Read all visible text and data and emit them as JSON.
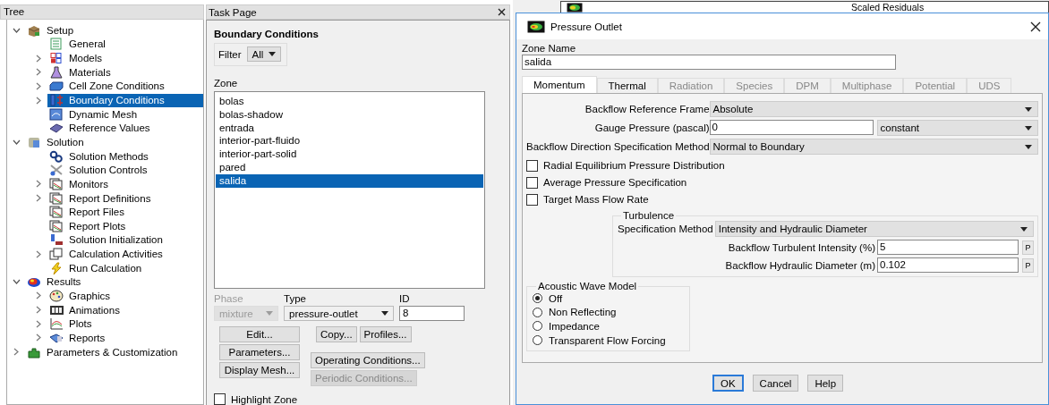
{
  "tree": {
    "title": "Tree",
    "items": [
      {
        "label": "Setup",
        "expanded": true,
        "selected": false,
        "children": [
          {
            "label": "General",
            "selected": false
          },
          {
            "label": "Models",
            "expanded": false,
            "selected": false
          },
          {
            "label": "Materials",
            "expanded": false,
            "selected": false
          },
          {
            "label": "Cell Zone Conditions",
            "expanded": false,
            "selected": false
          },
          {
            "label": "Boundary Conditions",
            "expanded": false,
            "selected": true
          },
          {
            "label": "Dynamic Mesh",
            "selected": false
          },
          {
            "label": "Reference Values",
            "selected": false
          }
        ]
      },
      {
        "label": "Solution",
        "expanded": true,
        "selected": false,
        "children": [
          {
            "label": "Solution Methods",
            "selected": false
          },
          {
            "label": "Solution Controls",
            "selected": false
          },
          {
            "label": "Monitors",
            "expanded": false,
            "selected": false
          },
          {
            "label": "Report Definitions",
            "expanded": false,
            "selected": false
          },
          {
            "label": "Report Files",
            "selected": false
          },
          {
            "label": "Report Plots",
            "selected": false
          },
          {
            "label": "Solution Initialization",
            "selected": false
          },
          {
            "label": "Calculation Activities",
            "expanded": false,
            "selected": false
          },
          {
            "label": "Run Calculation",
            "selected": false
          }
        ]
      },
      {
        "label": "Results",
        "expanded": true,
        "selected": false,
        "children": [
          {
            "label": "Graphics",
            "expanded": false,
            "selected": false
          },
          {
            "label": "Animations",
            "expanded": false,
            "selected": false
          },
          {
            "label": "Plots",
            "expanded": false,
            "selected": false
          },
          {
            "label": "Reports",
            "expanded": false,
            "selected": false
          }
        ]
      },
      {
        "label": "Parameters & Customization",
        "expanded": false,
        "selected": false
      }
    ]
  },
  "task_page": {
    "title": "Task Page",
    "heading": "Boundary Conditions",
    "filter": {
      "label": "Filter",
      "value": "All"
    },
    "zone": {
      "label": "Zone",
      "items": [
        {
          "label": "bolas",
          "selected": false
        },
        {
          "label": "bolas-shadow",
          "selected": false
        },
        {
          "label": "entrada",
          "selected": false
        },
        {
          "label": "interior-part-fluido",
          "selected": false
        },
        {
          "label": "interior-part-solid",
          "selected": false
        },
        {
          "label": "pared",
          "selected": false
        },
        {
          "label": "salida",
          "selected": true
        }
      ]
    },
    "phase": {
      "label": "Phase",
      "value": "mixture",
      "disabled": true
    },
    "type": {
      "label": "Type",
      "value": "pressure-outlet"
    },
    "id": {
      "label": "ID",
      "value": "8"
    },
    "buttons": [
      {
        "label": "Edit...",
        "disabled": false
      },
      {
        "label": "Parameters...",
        "disabled": false
      },
      {
        "label": "Display Mesh...",
        "disabled": false
      },
      {
        "label": "Copy...",
        "disabled": false
      },
      {
        "label": "Profiles...",
        "disabled": false
      },
      {
        "label": "Operating Conditions...",
        "disabled": false
      },
      {
        "label": "Periodic Conditions...",
        "disabled": true
      }
    ],
    "highlight_zone": {
      "label": "Highlight Zone",
      "checked": false
    }
  },
  "graphics_tab": {
    "title": "Scaled Residuals"
  },
  "dialog": {
    "title": "Pressure Outlet",
    "zone_name": {
      "label": "Zone Name",
      "value": "salida"
    },
    "tabs": [
      {
        "label": "Momentum",
        "selected": true,
        "disabled": false
      },
      {
        "label": "Thermal",
        "selected": false,
        "disabled": false
      },
      {
        "label": "Radiation",
        "selected": false,
        "disabled": true
      },
      {
        "label": "Species",
        "selected": false,
        "disabled": true
      },
      {
        "label": "DPM",
        "selected": false,
        "disabled": true
      },
      {
        "label": "Multiphase",
        "selected": false,
        "disabled": true
      },
      {
        "label": "Potential",
        "selected": false,
        "disabled": true
      },
      {
        "label": "UDS",
        "selected": false,
        "disabled": true
      }
    ],
    "fields": [
      {
        "kind": "dropdown",
        "label": "Backflow Reference Frame",
        "value": "Absolute"
      },
      {
        "kind": "input_dropdown",
        "label": "Gauge Pressure (pascal)",
        "value": "0",
        "option": "constant"
      },
      {
        "kind": "dropdown",
        "label": "Backflow Direction Specification Method",
        "value": "Normal to Boundary"
      },
      {
        "kind": "checkbox",
        "label": "Radial Equilibrium Pressure Distribution",
        "checked": false
      },
      {
        "kind": "checkbox",
        "label": "Average Pressure Specification",
        "checked": false
      },
      {
        "kind": "checkbox",
        "label": "Target Mass Flow Rate",
        "checked": false
      }
    ],
    "turbulence": {
      "title": "Turbulence",
      "method": {
        "label": "Specification Method",
        "value": "Intensity and Hydraulic Diameter"
      },
      "inputs": [
        {
          "label": "Backflow Turbulent Intensity (%)",
          "value": "5",
          "button": "P"
        },
        {
          "label": "Backflow Hydraulic Diameter (m)",
          "value": "0.102",
          "button": "P"
        }
      ]
    },
    "acoustic": {
      "title": "Acoustic Wave Model",
      "options": [
        {
          "label": "Off",
          "selected": true
        },
        {
          "label": "Non Reflecting",
          "selected": false
        },
        {
          "label": "Impedance",
          "selected": false
        },
        {
          "label": "Transparent Flow Forcing",
          "selected": false
        }
      ]
    },
    "buttons": [
      {
        "label": "OK",
        "default": true
      },
      {
        "label": "Cancel",
        "default": false
      },
      {
        "label": "Help",
        "default": false
      }
    ]
  }
}
